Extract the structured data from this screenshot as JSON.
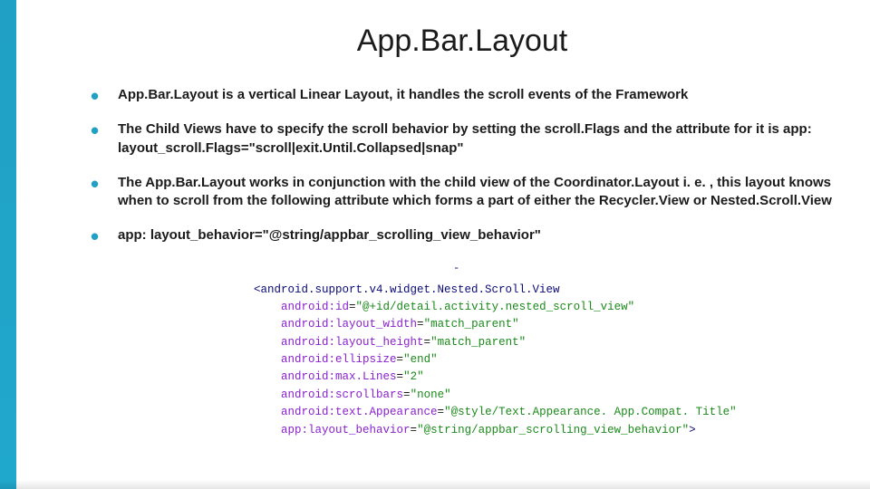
{
  "title": "App.Bar.Layout",
  "bullets": [
    "App.Bar.Layout is a vertical Linear Layout, it handles the scroll events of the Framework",
    "The Child Views have to specify the scroll behavior by setting the scroll.Flags and the attribute for it is app: layout_scroll.Flags=\"scroll|exit.Until.Collapsed|snap\"",
    "The App.Bar.Layout works in conjunction with the child view of the Coordinator.Layout  i. e. , this layout knows when to scroll from the following attribute which forms a part of either the Recycler.View or  Nested.Scroll.View",
    "app: layout_behavior=\"@string/appbar_scrolling_view_behavior\""
  ],
  "code": {
    "open_tag": "<android.support.v4.widget.Nested.Scroll.View",
    "attrs": [
      {
        "name": "android:id",
        "value": "\"@+id/detail.activity.nested_scroll_view\""
      },
      {
        "name": "android:layout_width",
        "value": "\"match_parent\""
      },
      {
        "name": "android:layout_height",
        "value": "\"match_parent\""
      },
      {
        "name": "android:ellipsize",
        "value": "\"end\""
      },
      {
        "name": "android:max.Lines",
        "value": "\"2\""
      },
      {
        "name": "android:scrollbars",
        "value": "\"none\""
      },
      {
        "name": "android:text.Appearance",
        "value": "\"@style/Text.Appearance. App.Compat. Title\""
      },
      {
        "name": "app:layout_behavior",
        "value": "\"@string/appbar_scrolling_view_behavior\""
      }
    ],
    "close_tag": ">"
  }
}
